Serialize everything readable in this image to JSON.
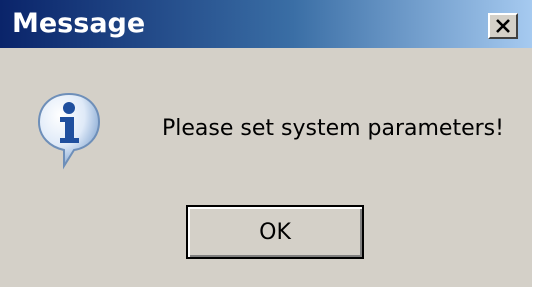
{
  "window": {
    "title": "Message",
    "close_icon": "close-icon"
  },
  "body": {
    "icon": "info-icon",
    "message": "Please set system parameters!"
  },
  "buttons": {
    "ok_label": "OK"
  },
  "colors": {
    "titlebar_start": "#0a246a",
    "titlebar_end": "#a6caf0",
    "dialog_bg": "#d4d0c8"
  }
}
